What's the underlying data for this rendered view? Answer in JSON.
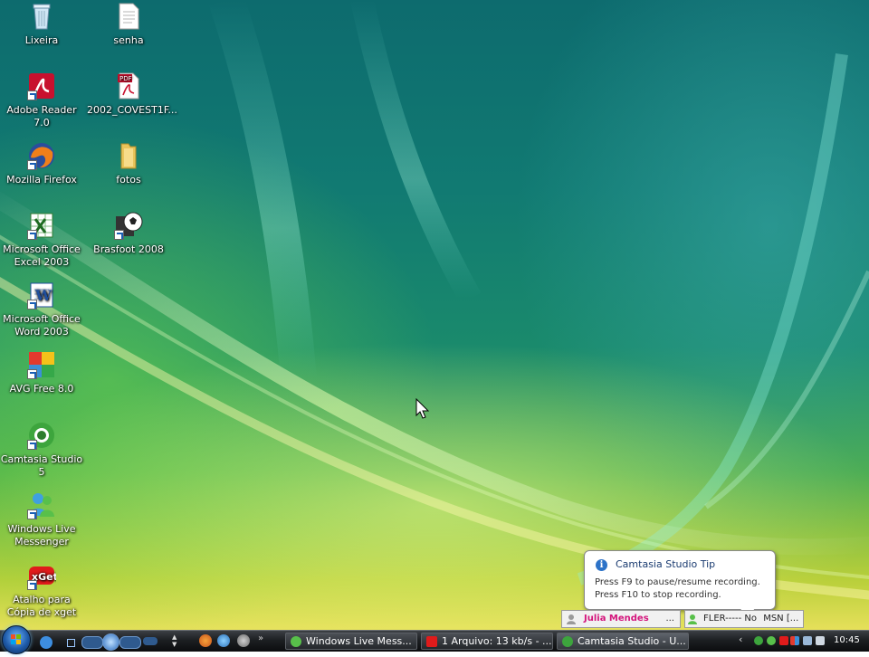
{
  "desktop": {
    "icons": [
      {
        "label": "Lixeira",
        "icon": "recycle-bin-icon"
      },
      {
        "label": "senha",
        "icon": "text-file-icon"
      },
      {
        "label": "Adobe Reader 7.0",
        "icon": "adobe-reader-icon"
      },
      {
        "label": "2002_COVEST1F...",
        "icon": "pdf-file-icon"
      },
      {
        "label": "Mozilla Firefox",
        "icon": "firefox-icon"
      },
      {
        "label": "fotos",
        "icon": "folder-icon"
      },
      {
        "label": "Microsoft Office Excel 2003",
        "icon": "excel-icon"
      },
      {
        "label": "Brasfoot 2008",
        "icon": "soccer-ball-icon"
      },
      {
        "label": "Microsoft Office Word 2003",
        "icon": "word-icon"
      },
      {
        "label": "AVG Free 8.0",
        "icon": "avg-icon"
      },
      {
        "label": "Camtasia Studio 5",
        "icon": "camtasia-icon"
      },
      {
        "label": "Windows Live Messenger",
        "icon": "messenger-icon"
      },
      {
        "label": "Atalho para Cópia de xget",
        "icon": "xget-icon"
      }
    ]
  },
  "balloon": {
    "title": "Camtasia Studio Tip",
    "line1": "Press F9 to pause/resume recording.",
    "line2": "Press F10 to stop recording."
  },
  "deskbar": {
    "contact1": "Julia Mendes",
    "contact1_more": "...",
    "contact2": "FLER----- No",
    "contact3": "MSN [..."
  },
  "taskbar": {
    "buttons": [
      {
        "label": "Windows Live Mess...",
        "icon": "messenger-icon"
      },
      {
        "label": "1 Arquivo: 13 kb/s - ...",
        "icon": "xget-icon"
      },
      {
        "label": "Camtasia Studio - U...",
        "icon": "camtasia-icon"
      }
    ],
    "clock": "10:45"
  },
  "colors": {
    "taskbar": "#1c1f22",
    "tip_icon": "#2d73c8",
    "contact_name": "#d4157c"
  }
}
